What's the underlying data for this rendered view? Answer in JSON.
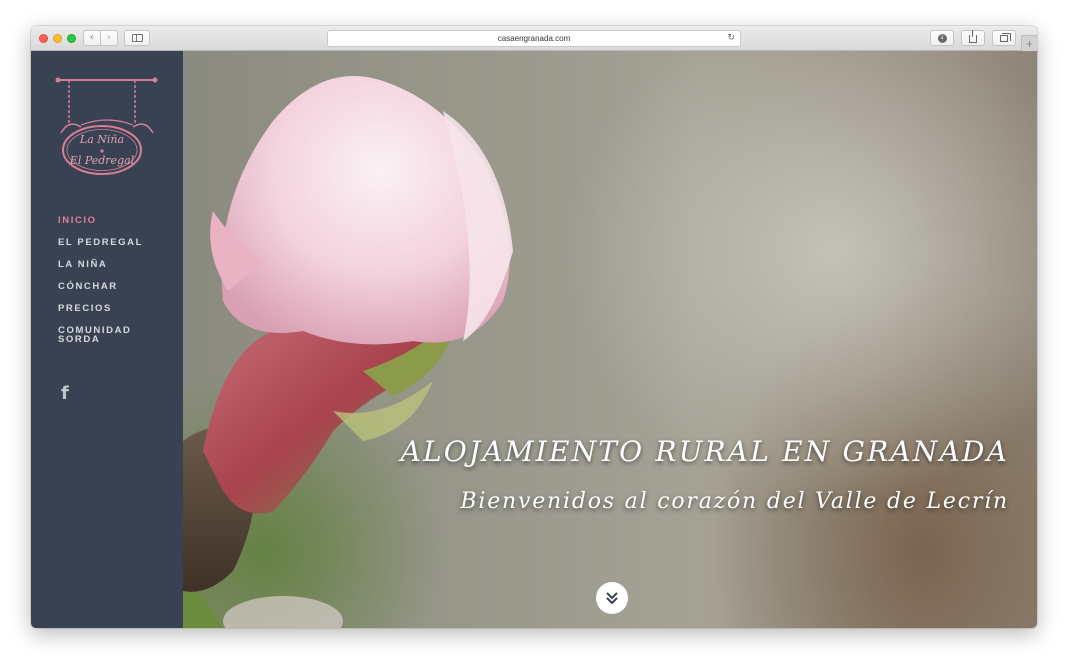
{
  "browser": {
    "url": "casaengranada.com"
  },
  "sidebar": {
    "logo_text_line1": "La Niña",
    "logo_text_line2": "El Pedregal",
    "menu": [
      {
        "label": "INICIO",
        "active": true
      },
      {
        "label": "EL PEDREGAL",
        "active": false
      },
      {
        "label": "LA NIÑA",
        "active": false
      },
      {
        "label": "CÓNCHAR",
        "active": false
      },
      {
        "label": "PRECIOS",
        "active": false
      },
      {
        "label": "COMUNIDAD SORDA",
        "active": false
      }
    ],
    "social_icon": "facebook-icon",
    "social_glyph": "f",
    "colors": {
      "background": "#384253",
      "active": "#e07f95",
      "text": "#d6d9dd"
    }
  },
  "hero": {
    "title": "ALOJAMIENTO RURAL EN GRANADA",
    "subtitle": "Bienvenidos al corazón del Valle de Lecrín",
    "scroll_icon": "double-chevron-down-icon"
  }
}
